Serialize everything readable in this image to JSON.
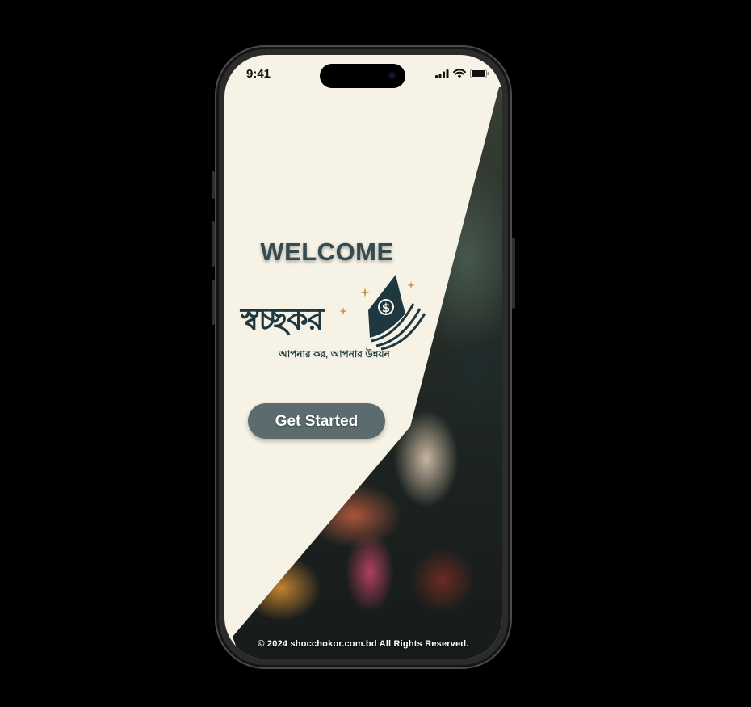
{
  "status_bar": {
    "time": "9:41"
  },
  "welcome": {
    "title": "WELCOME"
  },
  "brand": {
    "name": "স্বচ্ছকর",
    "tagline": "আপনার কর, আপনার উন্নয়ন"
  },
  "cta": {
    "label": "Get Started"
  },
  "footer": {
    "copyright": "© 2024 shocchokor.com.bd All Rights Reserved."
  },
  "colors": {
    "brand": "#1f3840",
    "welcome": "#354b52",
    "button": "#5b6b6e",
    "background": "#f6f2e6",
    "accent": "#c99a4b"
  },
  "icons": [
    "signal-icon",
    "wifi-icon",
    "battery-icon",
    "money-stack-icon",
    "sparkle-icon"
  ]
}
